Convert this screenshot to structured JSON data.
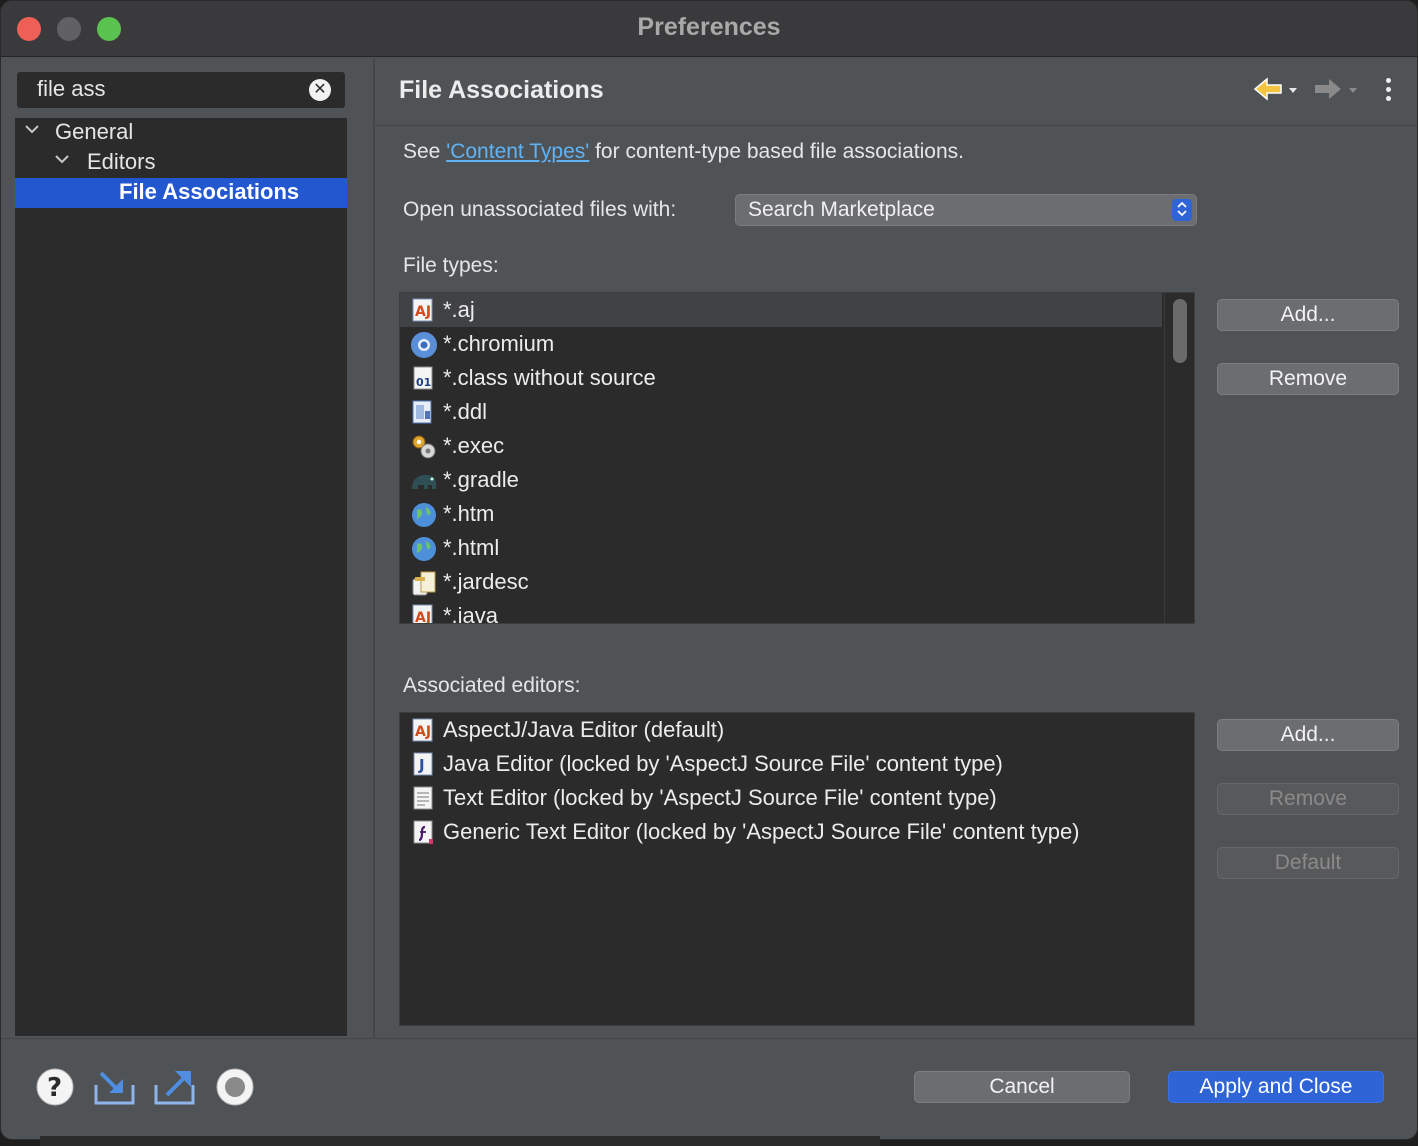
{
  "window": {
    "title": "Preferences"
  },
  "filter": {
    "value": "file ass",
    "clear_icon": "clear-circle-icon"
  },
  "tree": {
    "items": [
      {
        "label": "General",
        "expanded": true,
        "level": 0
      },
      {
        "label": "Editors",
        "expanded": true,
        "level": 1
      },
      {
        "label": "File Associations",
        "selected": true,
        "level": 2
      }
    ]
  },
  "page": {
    "title": "File Associations",
    "see_prefix": "See ",
    "see_link": "'Content Types'",
    "see_suffix": " for content-type based file associations.",
    "open_label": "Open unassociated files with:",
    "open_value": "Search Marketplace",
    "file_types_label": "File types:",
    "file_types": [
      {
        "label": "*.aj",
        "icon": "aspectj-file-icon"
      },
      {
        "label": "*.chromium",
        "icon": "chromium-globe-icon"
      },
      {
        "label": "*.class without source",
        "icon": "class-file-icon"
      },
      {
        "label": "*.ddl",
        "icon": "ddl-file-icon"
      },
      {
        "label": "*.exec",
        "icon": "exec-gears-icon"
      },
      {
        "label": "*.gradle",
        "icon": "gradle-elephant-icon"
      },
      {
        "label": "*.htm",
        "icon": "globe-icon"
      },
      {
        "label": "*.html",
        "icon": "globe-icon"
      },
      {
        "label": "*.jardesc",
        "icon": "jar-descriptor-icon"
      },
      {
        "label": "*.java",
        "icon": "aspectj-file-icon"
      }
    ],
    "assoc_label": "Associated editors:",
    "editors": [
      {
        "label": "AspectJ/Java Editor (default)",
        "icon": "aspectj-editor-icon"
      },
      {
        "label": "Java Editor (locked by 'AspectJ Source File' content type)",
        "icon": "java-editor-icon"
      },
      {
        "label": "Text Editor (locked by 'AspectJ Source File' content type)",
        "icon": "text-editor-icon"
      },
      {
        "label": "Generic Text Editor (locked by 'AspectJ Source File' content type)",
        "icon": "generic-editor-icon"
      }
    ],
    "ft_add": "Add...",
    "ft_remove": "Remove",
    "ae_add": "Add...",
    "ae_remove": "Remove",
    "ae_default": "Default"
  },
  "footer": {
    "cancel": "Cancel",
    "apply": "Apply and Close"
  },
  "colors": {
    "accent": "#2e64d6",
    "selection": "#2357d0",
    "link": "#5fb3f5"
  }
}
